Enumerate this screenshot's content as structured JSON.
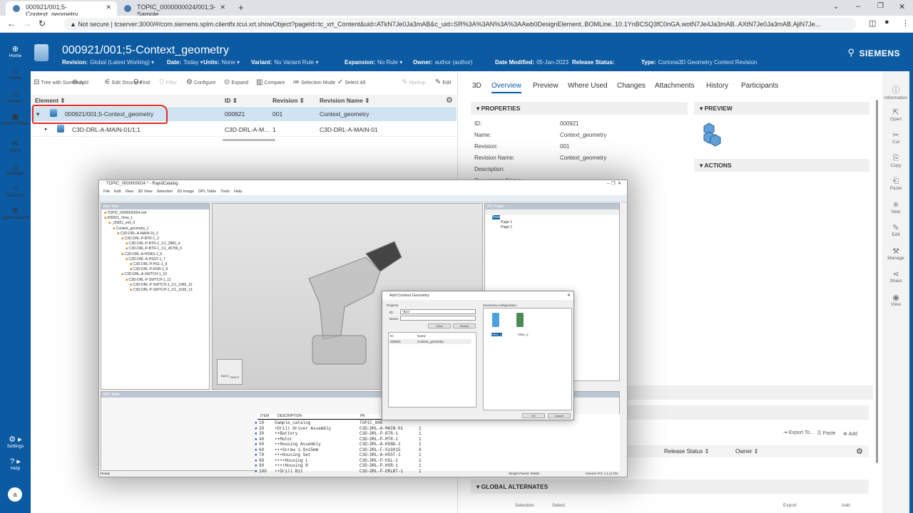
{
  "browser": {
    "tabs": [
      {
        "label": "000921/001;5-Context_geometry"
      },
      {
        "label": "TOPIC_0000000024/001;3-Sample"
      }
    ],
    "security": "Not secure",
    "url": "tcserver:3000/#/com.siemens.splm.clientfx.tcui.xrt.showObject?pageId=tc_xrt_Content&uid=ATkN7Je0Ja3mAB&c_uid=SR%3A%3AN%3A%3AAwb0DesignElement..BOMLine..10.1YnBCSQ3fC0nGA.wotN7Je4Ja3mAB..AXtN7Je0Ja3mAB.AjiN7Je..."
  },
  "header": {
    "title": "000921/001;5-Context_geometry",
    "brand": "SIEMENS",
    "meta": [
      {
        "k": "Revision:",
        "v": "Global (Latest Working) ▾"
      },
      {
        "k": "Date:",
        "v": "Today ▾"
      },
      {
        "k": "Units:",
        "v": "None ▾"
      },
      {
        "k": "Variant:",
        "v": "No Variant Rule ▾"
      },
      {
        "k": "Expansion:",
        "v": "No Rule ▾"
      },
      {
        "k": "Owner:",
        "v": "author (author)"
      },
      {
        "k": "Date Modified:",
        "v": "05-Jan-2023"
      },
      {
        "k": "Release Status:",
        "v": ""
      },
      {
        "k": "Type:",
        "v": "Cortona3D Geometry Context Revision"
      }
    ]
  },
  "sidebar": {
    "items": [
      {
        "label": "Home",
        "icon": "home-icon"
      },
      {
        "label": "Home",
        "icon": "home-icon"
      },
      {
        "label": "Folders",
        "icon": "folder-icon"
      },
      {
        "label": "Active Folders",
        "icon": "active-folder-icon"
      },
      {
        "label": "Inbox",
        "icon": "inbox-icon"
      },
      {
        "label": "Changes",
        "icon": "changes-icon"
      },
      {
        "label": "Favorites",
        "icon": "star-icon"
      },
      {
        "label": "Quick Access",
        "icon": "quick-access-icon"
      }
    ],
    "settings": "Settings",
    "help": "Help",
    "avatar": "a"
  },
  "toolbar": {
    "items": [
      "Tree with Summary",
      "Add",
      "Edit Structure",
      "Find",
      "Filter",
      "Configure",
      "Expand",
      "Compare",
      "Selection Mode",
      "Select All"
    ],
    "markup": "Markup",
    "edit": "Edit"
  },
  "grid": {
    "columns": [
      "Element ⇕",
      "ID ⇕",
      "Revision ⇕",
      "Revision Name ⇕"
    ],
    "rows": [
      [
        "000921/001;5-Context_geometry",
        "000921",
        "001",
        "Context_geometry"
      ],
      [
        "C3D-DRL-A-MAIN-01/1;1",
        "C3D-DRL-A-M...",
        "1",
        "C3D-DRL-A-MAIN-01"
      ]
    ]
  },
  "details": {
    "tabs": [
      "3D",
      "Overview",
      "Preview",
      "Where Used",
      "Changes",
      "Attachments",
      "History",
      "Participants"
    ],
    "active_tab": "Overview",
    "properties_title": "▾ PROPERTIES",
    "properties": [
      [
        "ID:",
        "000921"
      ],
      [
        "Name:",
        "Context_geometry"
      ],
      [
        "Revision:",
        "001"
      ],
      [
        "Revision Name:",
        "Context_geometry"
      ],
      [
        "Description:",
        ""
      ],
      [
        "Occurrence Name:",
        ""
      ]
    ],
    "preview_title": "▾ PREVIEW",
    "actions_title": "▾ ACTIONS",
    "table_actions": [
      "Export To...",
      "Paste",
      "Add"
    ],
    "table_cols": [
      "Release Status ⇕",
      "Owner ⇕"
    ],
    "global_alternates": "▾ GLOBAL ALTERNATES",
    "bottom_actions": [
      "Selection",
      "Select",
      "Export",
      "Add"
    ]
  },
  "right_tools": [
    "Information",
    "Open",
    "Cut",
    "Copy",
    "Paste",
    "New",
    "Edit",
    "Manage",
    "Share",
    "View"
  ],
  "rapidcatalog": {
    "title": "TOPIC_0000000024 * - RapidCatalog",
    "menu": [
      "File",
      "Edit",
      "View",
      "3D View",
      "Selection",
      "2D Image",
      "DPL Table",
      "Tools",
      "Help"
    ],
    "item_tree_title": "Item Tree",
    "tree": [
      "TOPIC_0000000024.xml",
      "000921_View_1",
      "_00921_xml_0",
      "Context_geometry_1",
      "C3D-DRL-A-MAIN-01_2",
      "C3D-DRL-P-BTR-1_3",
      "C3D-DRL-P-BTR-1_1\\1_2880_4",
      "C3D-DRL-P-BTR-1_1\\1_45786_5",
      "C3D-DRL-A-HSNG-1_6",
      "C3D-DRL-A-HSST-1_7",
      "C3D-DRL-P-HSL-1_8",
      "C3D-DRL-P-HSR-1_9",
      "C3D-DRL-A-SWTCH-1_10",
      "C3D-DRL-P-SWTCH-1_11",
      "C3D-DRL-P-SWTCH-1_1\\1_1065_12",
      "C3D-DRL-P-SWTCH-1_1\\1_1639_13"
    ],
    "ipc_title": "IPC Pages",
    "ipc_tree": [
      "Base",
      "Page 1",
      "Page 2"
    ],
    "cube": [
      "TOP",
      "BACK",
      "RIGHT"
    ],
    "dpl_title": "DPL Table",
    "dpl_cols": [
      "ITEM",
      "DESCRIPTION",
      "PA"
    ],
    "dpl_rows": [
      [
        "10",
        "Sample_catalog",
        "TOPIC_000",
        "",
        ""
      ],
      [
        "20",
        "•Drill Driver Assembly",
        "C3D-DRL-A-MAIN-01",
        "1"
      ],
      [
        "30",
        "••Battery",
        "C3D-DRL-P-BTR-1",
        "1"
      ],
      [
        "40",
        "••Motor",
        "C3D-DRL-P-MTR-1",
        "1"
      ],
      [
        "50",
        "••Housing Assembly",
        "C3D-DRL-A-HSNG-1",
        "1"
      ],
      [
        "60",
        "•••Screw 1.9x15mm",
        "C3D-DRL-F-S19X15",
        "8"
      ],
      [
        "70",
        "•••Housing Set",
        "C3D-DRL-A-HSST-1",
        "1"
      ],
      [
        "80",
        "••••Housing L",
        "C3D-DRL-P-HSL-1",
        "1"
      ],
      [
        "90",
        "••••Housing R",
        "C3D-DRL-P-HSR-1",
        "1"
      ],
      [
        "100",
        "••Drill Bit",
        "C3D-DRL-P-DRLBT-1",
        "1"
      ]
    ],
    "status": "Ready",
    "weight": "Weight Parent: 96562",
    "generic": "Generic IPC v.1.12   EN"
  },
  "dialog": {
    "title": "Add Context Geometry",
    "projects": "Projects",
    "id_label": "ID:",
    "id_value": "*921*",
    "name_label": "Name:",
    "clear": "Clear",
    "search": "Search",
    "cols": [
      "ID",
      "Name"
    ],
    "row": [
      "000921",
      "Context_geometry"
    ],
    "geo_label": "Geometry configuration:",
    "views": [
      "View_1",
      "View_2"
    ],
    "ok": "OK",
    "cancel": "Cancel"
  }
}
